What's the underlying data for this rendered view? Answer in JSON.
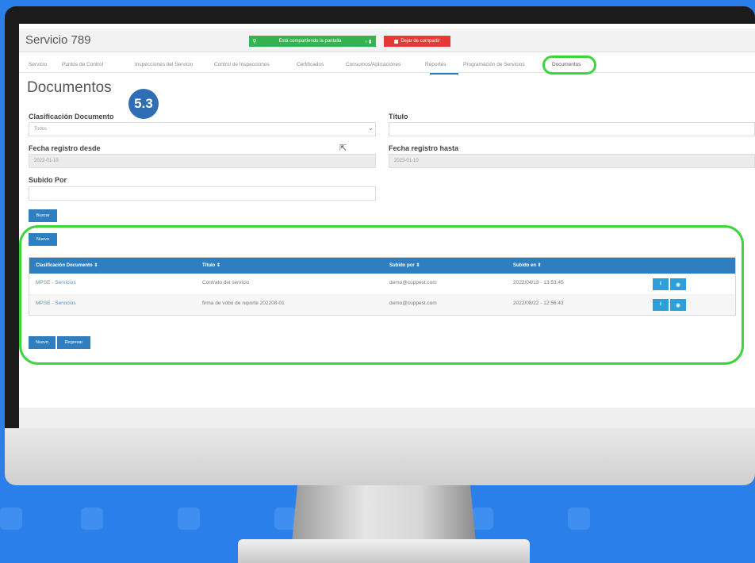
{
  "window": {
    "title": "Servicio 789"
  },
  "screen_share": {
    "message": "Está compartiendo la pantalla",
    "stop_label": "Dejar de compartir"
  },
  "tabs": [
    "Servicio",
    "Puntos de Control",
    "Inspecciones del Servicio",
    "Control de Inspecciones",
    "Certificados",
    "Consumos/Aplicaciones",
    "Reportes",
    "Programación de Servicios",
    "Documentos"
  ],
  "page": {
    "title": "Documentos",
    "step_badge": "5.3"
  },
  "filters": {
    "clasificacion": {
      "label": "Clasificación Documento",
      "value": "Todos"
    },
    "titulo": {
      "label": "Título",
      "value": ""
    },
    "fecha_desde": {
      "label": "Fecha registro desde",
      "value": "2022-01-10"
    },
    "fecha_hasta": {
      "label": "Fecha registro hasta",
      "value": "2023-01-10"
    },
    "subido_por": {
      "label": "Subido Por",
      "value": ""
    }
  },
  "buttons": {
    "buscar": "Buscar",
    "nuevo_top": "Nuevo",
    "nuevo_bottom": "Nuevo",
    "regresar": "Regresar"
  },
  "table": {
    "headers": [
      "Clasificación Documento ⇕",
      "Título ⇕",
      "Subido por ⇕",
      "Subido en ⇕"
    ],
    "rows": [
      [
        "MPSE - Servicios",
        "Contrato del servicio",
        "demo@cuppest.com",
        "2022/04/13 - 13:53:45"
      ],
      [
        "MPSE - Servicios",
        "firma de vobo de reporte 202208-01",
        "demo@cuppest.com",
        "2022/08/22 - 12:56:43"
      ]
    ]
  },
  "colors": {
    "accent": "#2f7fc0",
    "highlight": "#3ed43e",
    "share_green": "#34b350",
    "stop_red": "#e53935",
    "background": "#2a7fe8"
  }
}
